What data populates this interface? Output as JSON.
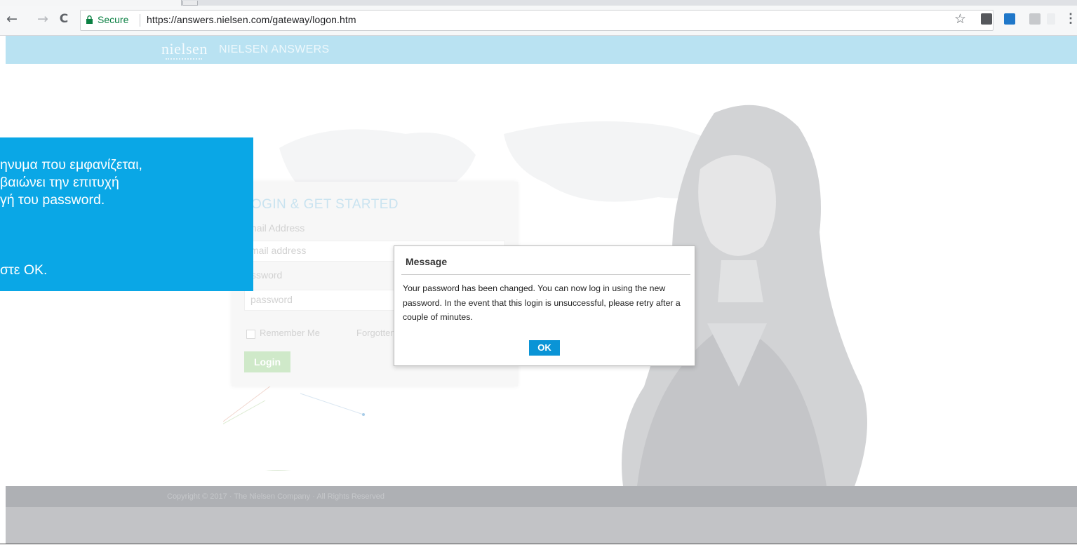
{
  "browser": {
    "address": {
      "secure_label": "Secure",
      "url": "https://answers.nielsen.com/gateway/logon.htm"
    },
    "icons": [
      "back-arrow-icon",
      "forward-arrow-icon",
      "reload-icon",
      "lock-icon",
      "star-icon",
      "extension-icons",
      "menu-icon"
    ],
    "nav": {
      "back": "←",
      "forward": "→",
      "reload": "C",
      "star": "☆",
      "menu": "⋮"
    }
  },
  "header": {
    "logo": "nielsen",
    "title": "NIELSEN ANSWERS"
  },
  "login": {
    "title": "OGIN & GET STARTED",
    "email_label": "nail Address",
    "email_placeholder": "mail address",
    "password_label": "ssword",
    "password_placeholder": "password",
    "remember": "Remember Me",
    "forgot": "Forgotten",
    "button": "Login"
  },
  "dialog": {
    "title": "Message",
    "message": "Your password has been changed. You can now log in using the new password. In the event that this login is unsuccessful, please retry after a couple of minutes.",
    "ok": "OK"
  },
  "footer": {
    "copyright": "Copyright © 2017 · The Nielsen Company · All Rights Reserved"
  },
  "callout": {
    "line1": "ηνυμα που εμφανίζεται,",
    "line2": "βαιώνει την επιτυχή",
    "line3": "γή του password.",
    "line4": "στε OK."
  },
  "colors": {
    "nav": "#b9e2f2",
    "callout": "#0aa7e6",
    "ok": "#0a94d6",
    "secure": "#0b8043"
  }
}
